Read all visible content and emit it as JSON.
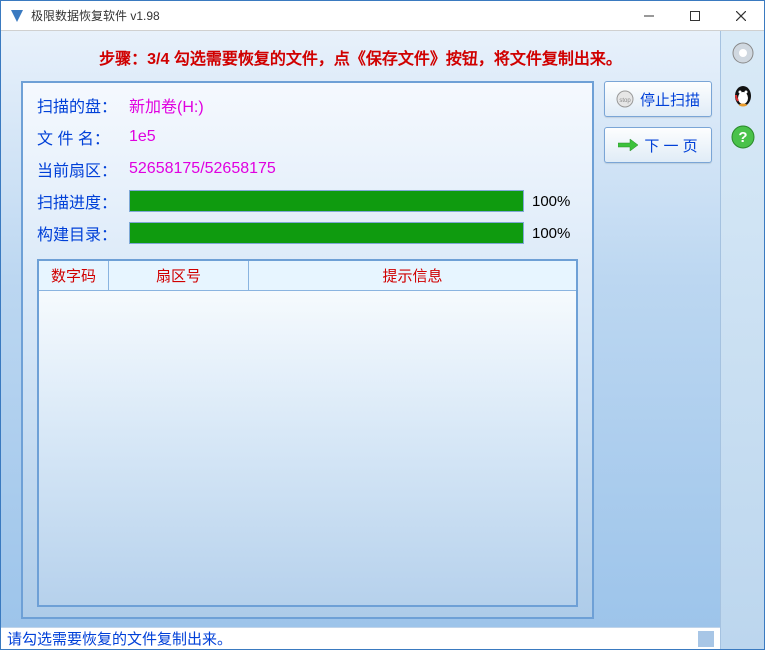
{
  "window": {
    "title": "极限数据恢复软件 v1.98"
  },
  "banner": {
    "text": "步骤：3/4 勾选需要恢复的文件，点《保存文件》按钮，将文件复制出来。"
  },
  "info": {
    "disk_label": "扫描的盘：",
    "disk_value": "新加卷(H:)",
    "filename_label": "文 件 名：",
    "filename_value": "1e5",
    "sector_label": "当前扇区：",
    "sector_value": "52658175/52658175"
  },
  "progress": {
    "scan_label": "扫描进度：",
    "scan_pct": "100%",
    "build_label": "构建目录：",
    "build_pct": "100%"
  },
  "table": {
    "col1": "数字码",
    "col2": "扇区号",
    "col3": "提示信息"
  },
  "buttons": {
    "stop": "停止扫描",
    "next": "下 一 页"
  },
  "footer": {
    "hint": "请勾选需要恢复的文件复制出来。"
  }
}
